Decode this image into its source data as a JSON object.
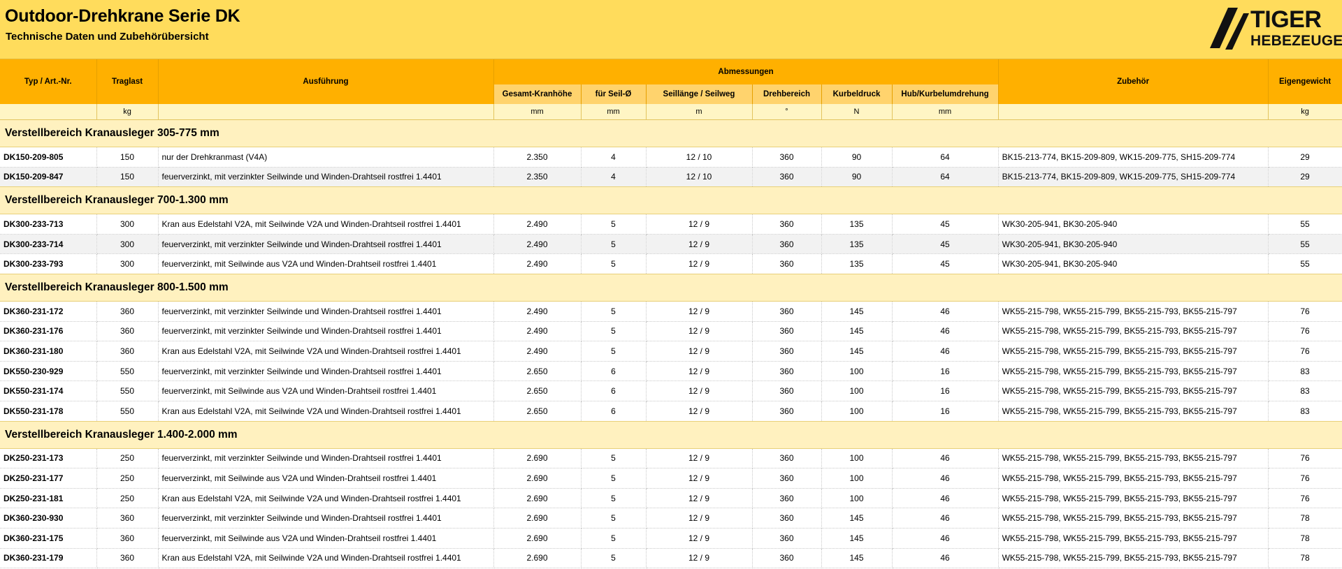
{
  "header": {
    "title": "Outdoor-Drehkrane Serie DK",
    "subtitle": "Technische Daten und Zubehörübersicht",
    "logo_line1": "TIGER",
    "logo_line2": "HEBEZEUGE"
  },
  "columns": {
    "typ": "Typ / Art.-Nr.",
    "traglast": "Traglast",
    "ausfuehrung": "Ausführung",
    "abmessungen": "Abmessungen",
    "gesamt": "Gesamt-Kranhöhe",
    "seil": "für Seil-Ø",
    "seillaenge": "Seillänge / Seilweg",
    "drehbereich": "Drehbereich",
    "kurbeldruck": "Kurbeldruck",
    "hub": "Hub/Kurbelumdrehung",
    "zubehoer": "Zubehör",
    "eigengewicht": "Eigengewicht"
  },
  "units": {
    "typ": "",
    "traglast": "kg",
    "ausfuehrung": "",
    "gesamt": "mm",
    "seil": "mm",
    "seillaenge": "m",
    "drehbereich": "°",
    "kurbeldruck": "N",
    "hub": "mm",
    "zubehoer": "",
    "eigengewicht": "kg"
  },
  "sections": [
    {
      "title": "Verstellbereich Kranausleger 305-775 mm",
      "rows": [
        {
          "typ": "DK150-209-805",
          "traglast": "150",
          "ausfuehrung": "nur der Drehkranmast (V4A)",
          "gesamt": "2.350",
          "seil": "4",
          "seillaenge": "12 / 10",
          "drehbereich": "360",
          "kurbeldruck": "90",
          "hub": "64",
          "zubehoer": "BK15-213-774, BK15-209-809, WK15-209-775, SH15-209-774",
          "eigengewicht": "29"
        },
        {
          "typ": "DK150-209-847",
          "traglast": "150",
          "ausfuehrung": "feuerverzinkt, mit verzinkter Seilwinde und Winden-Drahtseil rostfrei 1.4401",
          "gesamt": "2.350",
          "seil": "4",
          "seillaenge": "12 / 10",
          "drehbereich": "360",
          "kurbeldruck": "90",
          "hub": "64",
          "zubehoer": "BK15-213-774, BK15-209-809, WK15-209-775, SH15-209-774",
          "eigengewicht": "29"
        }
      ]
    },
    {
      "title": "Verstellbereich Kranausleger 700-1.300 mm",
      "rows": [
        {
          "typ": "DK300-233-713",
          "traglast": "300",
          "ausfuehrung": "Kran aus Edelstahl V2A, mit Seilwinde V2A und Winden-Drahtseil rostfrei 1.4401",
          "gesamt": "2.490",
          "seil": "5",
          "seillaenge": "12 / 9",
          "drehbereich": "360",
          "kurbeldruck": "135",
          "hub": "45",
          "zubehoer": "WK30-205-941, BK30-205-940",
          "eigengewicht": "55"
        },
        {
          "typ": "DK300-233-714",
          "traglast": "300",
          "ausfuehrung": "feuerverzinkt, mit verzinkter Seilwinde und Winden-Drahtseil rostfrei 1.4401",
          "gesamt": "2.490",
          "seil": "5",
          "seillaenge": "12 / 9",
          "drehbereich": "360",
          "kurbeldruck": "135",
          "hub": "45",
          "zubehoer": "WK30-205-941, BK30-205-940",
          "eigengewicht": "55"
        },
        {
          "typ": "DK300-233-793",
          "traglast": "300",
          "ausfuehrung": "feuerverzinkt, mit Seilwinde aus V2A und Winden-Drahtseil rostfrei 1.4401",
          "gesamt": "2.490",
          "seil": "5",
          "seillaenge": "12 / 9",
          "drehbereich": "360",
          "kurbeldruck": "135",
          "hub": "45",
          "zubehoer": "WK30-205-941, BK30-205-940",
          "eigengewicht": "55"
        }
      ]
    },
    {
      "title": "Verstellbereich Kranausleger 800-1.500 mm",
      "rows": [
        {
          "typ": "DK360-231-172",
          "traglast": "360",
          "ausfuehrung": "feuerverzinkt, mit verzinkter Seilwinde und Winden-Drahtseil rostfrei 1.4401",
          "gesamt": "2.490",
          "seil": "5",
          "seillaenge": "12 / 9",
          "drehbereich": "360",
          "kurbeldruck": "145",
          "hub": "46",
          "zubehoer": "WK55-215-798, WK55-215-799, BK55-215-793, BK55-215-797",
          "eigengewicht": "76"
        },
        {
          "typ": "DK360-231-176",
          "traglast": "360",
          "ausfuehrung": "feuerverzinkt, mit verzinkter Seilwinde und Winden-Drahtseil rostfrei 1.4401",
          "gesamt": "2.490",
          "seil": "5",
          "seillaenge": "12 / 9",
          "drehbereich": "360",
          "kurbeldruck": "145",
          "hub": "46",
          "zubehoer": "WK55-215-798, WK55-215-799, BK55-215-793, BK55-215-797",
          "eigengewicht": "76"
        },
        {
          "typ": "DK360-231-180",
          "traglast": "360",
          "ausfuehrung": "Kran aus Edelstahl V2A, mit Seilwinde V2A und Winden-Drahtseil rostfrei 1.4401",
          "gesamt": "2.490",
          "seil": "5",
          "seillaenge": "12 / 9",
          "drehbereich": "360",
          "kurbeldruck": "145",
          "hub": "46",
          "zubehoer": "WK55-215-798, WK55-215-799, BK55-215-793, BK55-215-797",
          "eigengewicht": "76"
        },
        {
          "typ": "DK550-230-929",
          "traglast": "550",
          "ausfuehrung": "feuerverzinkt, mit verzinkter Seilwinde und Winden-Drahtseil rostfrei 1.4401",
          "gesamt": "2.650",
          "seil": "6",
          "seillaenge": "12 / 9",
          "drehbereich": "360",
          "kurbeldruck": "100",
          "hub": "16",
          "zubehoer": "WK55-215-798, WK55-215-799, BK55-215-793, BK55-215-797",
          "eigengewicht": "83"
        },
        {
          "typ": "DK550-231-174",
          "traglast": "550",
          "ausfuehrung": "feuerverzinkt, mit Seilwinde aus V2A und Winden-Drahtseil rostfrei 1.4401",
          "gesamt": "2.650",
          "seil": "6",
          "seillaenge": "12 / 9",
          "drehbereich": "360",
          "kurbeldruck": "100",
          "hub": "16",
          "zubehoer": "WK55-215-798, WK55-215-799, BK55-215-793, BK55-215-797",
          "eigengewicht": "83"
        },
        {
          "typ": "DK550-231-178",
          "traglast": "550",
          "ausfuehrung": "Kran aus Edelstahl V2A, mit Seilwinde V2A und Winden-Drahtseil rostfrei 1.4401",
          "gesamt": "2.650",
          "seil": "6",
          "seillaenge": "12 / 9",
          "drehbereich": "360",
          "kurbeldruck": "100",
          "hub": "16",
          "zubehoer": "WK55-215-798, WK55-215-799, BK55-215-793, BK55-215-797",
          "eigengewicht": "83"
        }
      ]
    },
    {
      "title": "Verstellbereich Kranausleger 1.400-2.000 mm",
      "rows": [
        {
          "typ": "DK250-231-173",
          "traglast": "250",
          "ausfuehrung": "feuerverzinkt, mit verzinkter Seilwinde und Winden-Drahtseil rostfrei 1.4401",
          "gesamt": "2.690",
          "seil": "5",
          "seillaenge": "12 / 9",
          "drehbereich": "360",
          "kurbeldruck": "100",
          "hub": "46",
          "zubehoer": "WK55-215-798, WK55-215-799, BK55-215-793, BK55-215-797",
          "eigengewicht": "76"
        },
        {
          "typ": "DK250-231-177",
          "traglast": "250",
          "ausfuehrung": "feuerverzinkt, mit Seilwinde aus V2A und Winden-Drahtseil rostfrei 1.4401",
          "gesamt": "2.690",
          "seil": "5",
          "seillaenge": "12 / 9",
          "drehbereich": "360",
          "kurbeldruck": "100",
          "hub": "46",
          "zubehoer": "WK55-215-798, WK55-215-799, BK55-215-793, BK55-215-797",
          "eigengewicht": "76"
        },
        {
          "typ": "DK250-231-181",
          "traglast": "250",
          "ausfuehrung": "Kran aus Edelstahl V2A, mit Seilwinde V2A und Winden-Drahtseil rostfrei 1.4401",
          "gesamt": "2.690",
          "seil": "5",
          "seillaenge": "12 / 9",
          "drehbereich": "360",
          "kurbeldruck": "100",
          "hub": "46",
          "zubehoer": "WK55-215-798, WK55-215-799, BK55-215-793, BK55-215-797",
          "eigengewicht": "76"
        },
        {
          "typ": "DK360-230-930",
          "traglast": "360",
          "ausfuehrung": "feuerverzinkt, mit verzinkter Seilwinde und Winden-Drahtseil rostfrei 1.4401",
          "gesamt": "2.690",
          "seil": "5",
          "seillaenge": "12 / 9",
          "drehbereich": "360",
          "kurbeldruck": "145",
          "hub": "46",
          "zubehoer": "WK55-215-798, WK55-215-799, BK55-215-793, BK55-215-797",
          "eigengewicht": "78"
        },
        {
          "typ": "DK360-231-175",
          "traglast": "360",
          "ausfuehrung": "feuerverzinkt, mit Seilwinde aus V2A und Winden-Drahtseil rostfrei 1.4401",
          "gesamt": "2.690",
          "seil": "5",
          "seillaenge": "12 / 9",
          "drehbereich": "360",
          "kurbeldruck": "145",
          "hub": "46",
          "zubehoer": "WK55-215-798, WK55-215-799, BK55-215-793, BK55-215-797",
          "eigengewicht": "78"
        },
        {
          "typ": "DK360-231-179",
          "traglast": "360",
          "ausfuehrung": "Kran aus Edelstahl V2A, mit Seilwinde V2A und Winden-Drahtseil rostfrei 1.4401",
          "gesamt": "2.690",
          "seil": "5",
          "seillaenge": "12 / 9",
          "drehbereich": "360",
          "kurbeldruck": "145",
          "hub": "46",
          "zubehoer": "WK55-215-798, WK55-215-799, BK55-215-793, BK55-215-797",
          "eigengewicht": "78"
        }
      ]
    }
  ]
}
